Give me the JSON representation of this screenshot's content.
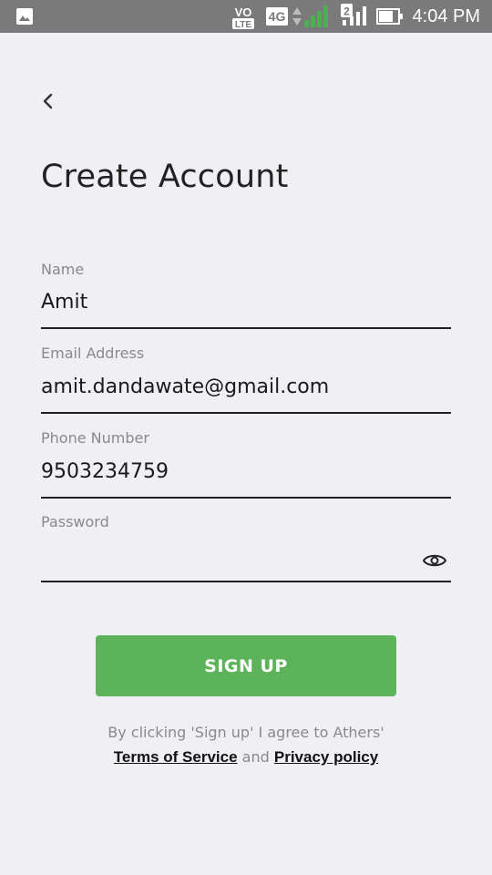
{
  "status_bar": {
    "volte_top": "VO",
    "volte_bottom": "LTE",
    "network": "4G",
    "sim2": "2",
    "time": "4:04 PM"
  },
  "page": {
    "title": "Create Account"
  },
  "form": {
    "name": {
      "label": "Name",
      "value": "Amit"
    },
    "email": {
      "label": "Email Address",
      "value": "amit.dandawate@gmail.com"
    },
    "phone": {
      "label": "Phone Number",
      "value": "9503234759"
    },
    "password": {
      "label": "Password",
      "value": ""
    }
  },
  "actions": {
    "signup_label": "SIGN UP"
  },
  "terms": {
    "prefix": "By clicking 'Sign up' I agree to Athers'",
    "tos_label": "Terms of Service",
    "and": "and",
    "privacy_label": "Privacy policy"
  },
  "colors": {
    "status_bar": "#7a7a7a",
    "background": "#efeff4",
    "accent_green": "#5db35a"
  }
}
